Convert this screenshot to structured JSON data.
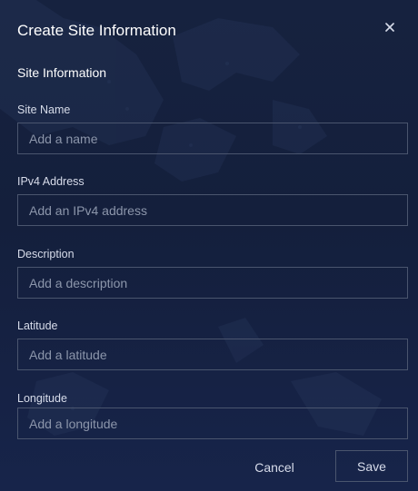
{
  "dialog": {
    "title": "Create Site Information",
    "close_glyph": "×",
    "section_title": "Site Information"
  },
  "fields": {
    "site_name": {
      "label": "Site Name",
      "placeholder": "Add a name",
      "value": ""
    },
    "ipv4": {
      "label": "IPv4 Address",
      "placeholder": "Add an IPv4 address",
      "value": ""
    },
    "description": {
      "label": "Description",
      "placeholder": "Add a description",
      "value": ""
    },
    "latitude": {
      "label": "Latitude",
      "placeholder": "Add a latitude",
      "value": ""
    },
    "longitude": {
      "label": "Longitude",
      "placeholder": "Add a longitude",
      "value": ""
    }
  },
  "actions": {
    "cancel_label": "Cancel",
    "save_label": "Save"
  },
  "colors": {
    "background": "#16223f",
    "border": "#4a556e",
    "placeholder": "#8c96ab",
    "text": "#ffffff"
  },
  "icons": {
    "close": "close-icon",
    "background": "world-map-icon"
  }
}
